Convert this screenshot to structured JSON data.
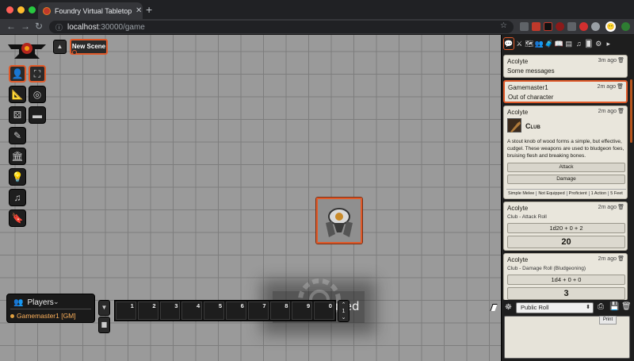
{
  "browser": {
    "tab_title": "Foundry Virtual Tabletop • A Sh",
    "tab_close": "✕",
    "new_tab": "+",
    "url_host": "localhost",
    "url_path": ":30000/game",
    "back": "←",
    "forward": "→",
    "reload": "↻",
    "menu": "⋮",
    "profile_initial": "😶"
  },
  "scene": {
    "nav_toggle": "▲",
    "active_scene": "New Scene"
  },
  "controls": [
    {
      "name": "token-controls-icon",
      "glyph": "👤",
      "active": true
    },
    {
      "name": "select-icon",
      "glyph": "⛶",
      "active": true
    },
    {
      "name": "measure-icon",
      "glyph": "📐",
      "active": false
    },
    {
      "name": "target-icon",
      "glyph": "◎",
      "active": false
    },
    {
      "name": "tiles-icon",
      "glyph": "⚄",
      "active": false
    },
    {
      "name": "ruler-icon",
      "glyph": "▬",
      "active": false
    },
    {
      "name": "drawing-icon",
      "glyph": "✎",
      "active": false
    },
    {
      "name": "walls-icon",
      "glyph": "🏛",
      "active": false
    },
    {
      "name": "lighting-icon",
      "glyph": "💡",
      "active": false
    },
    {
      "name": "sounds-icon",
      "glyph": "♫",
      "active": false
    },
    {
      "name": "notes-icon",
      "glyph": "🔖",
      "active": false
    }
  ],
  "pause": {
    "text": "Game Paused"
  },
  "players": {
    "title": "Players",
    "chevron": "⌄",
    "list": [
      {
        "name": "Gamemaster1 [GM]"
      }
    ]
  },
  "hotbar": {
    "slots": [
      "1",
      "2",
      "3",
      "4",
      "5",
      "6",
      "7",
      "8",
      "9",
      "0"
    ],
    "page": "1",
    "collapse": "▼",
    "folder": "▆"
  },
  "sidebar": {
    "tabs": [
      "💬",
      "⚔",
      "🗺",
      "👥",
      "🧳",
      "📖",
      "▤",
      "♫",
      "🂠",
      "⚙",
      "▸"
    ],
    "messages": [
      {
        "sender": "Acolyte",
        "time": "3m ago",
        "body": "Some messages"
      },
      {
        "sender": "Gamemaster1",
        "time": "2m ago",
        "body": "Out of character"
      },
      {
        "sender": "Acolyte",
        "time": "2m ago",
        "item_name": "Club",
        "description": "A stout knob of wood forms a simple, but effective, cudgel. These weapons are used to bludgeon foes, bruising flesh and breaking bones.",
        "buttons": [
          "Attack",
          "Damage"
        ],
        "tags": [
          "Simple Melee",
          "Not Equipped",
          "Proficient",
          "1 Action",
          "5 Feet"
        ]
      },
      {
        "sender": "Acolyte",
        "time": "2m ago",
        "flavor": "Club - Attack Roll",
        "formula": "1d20 + 0 + 2",
        "total": "20"
      },
      {
        "sender": "Acolyte",
        "time": "2m ago",
        "flavor": "Club - Damage Roll (Bludgeoning)",
        "formula": "1d4 + 0 + 0",
        "total": "3"
      }
    ],
    "delete_glyph": "🗑",
    "roll_mode": "Public Roll",
    "roll_arrow": "⬍",
    "tooltip": "Print"
  }
}
